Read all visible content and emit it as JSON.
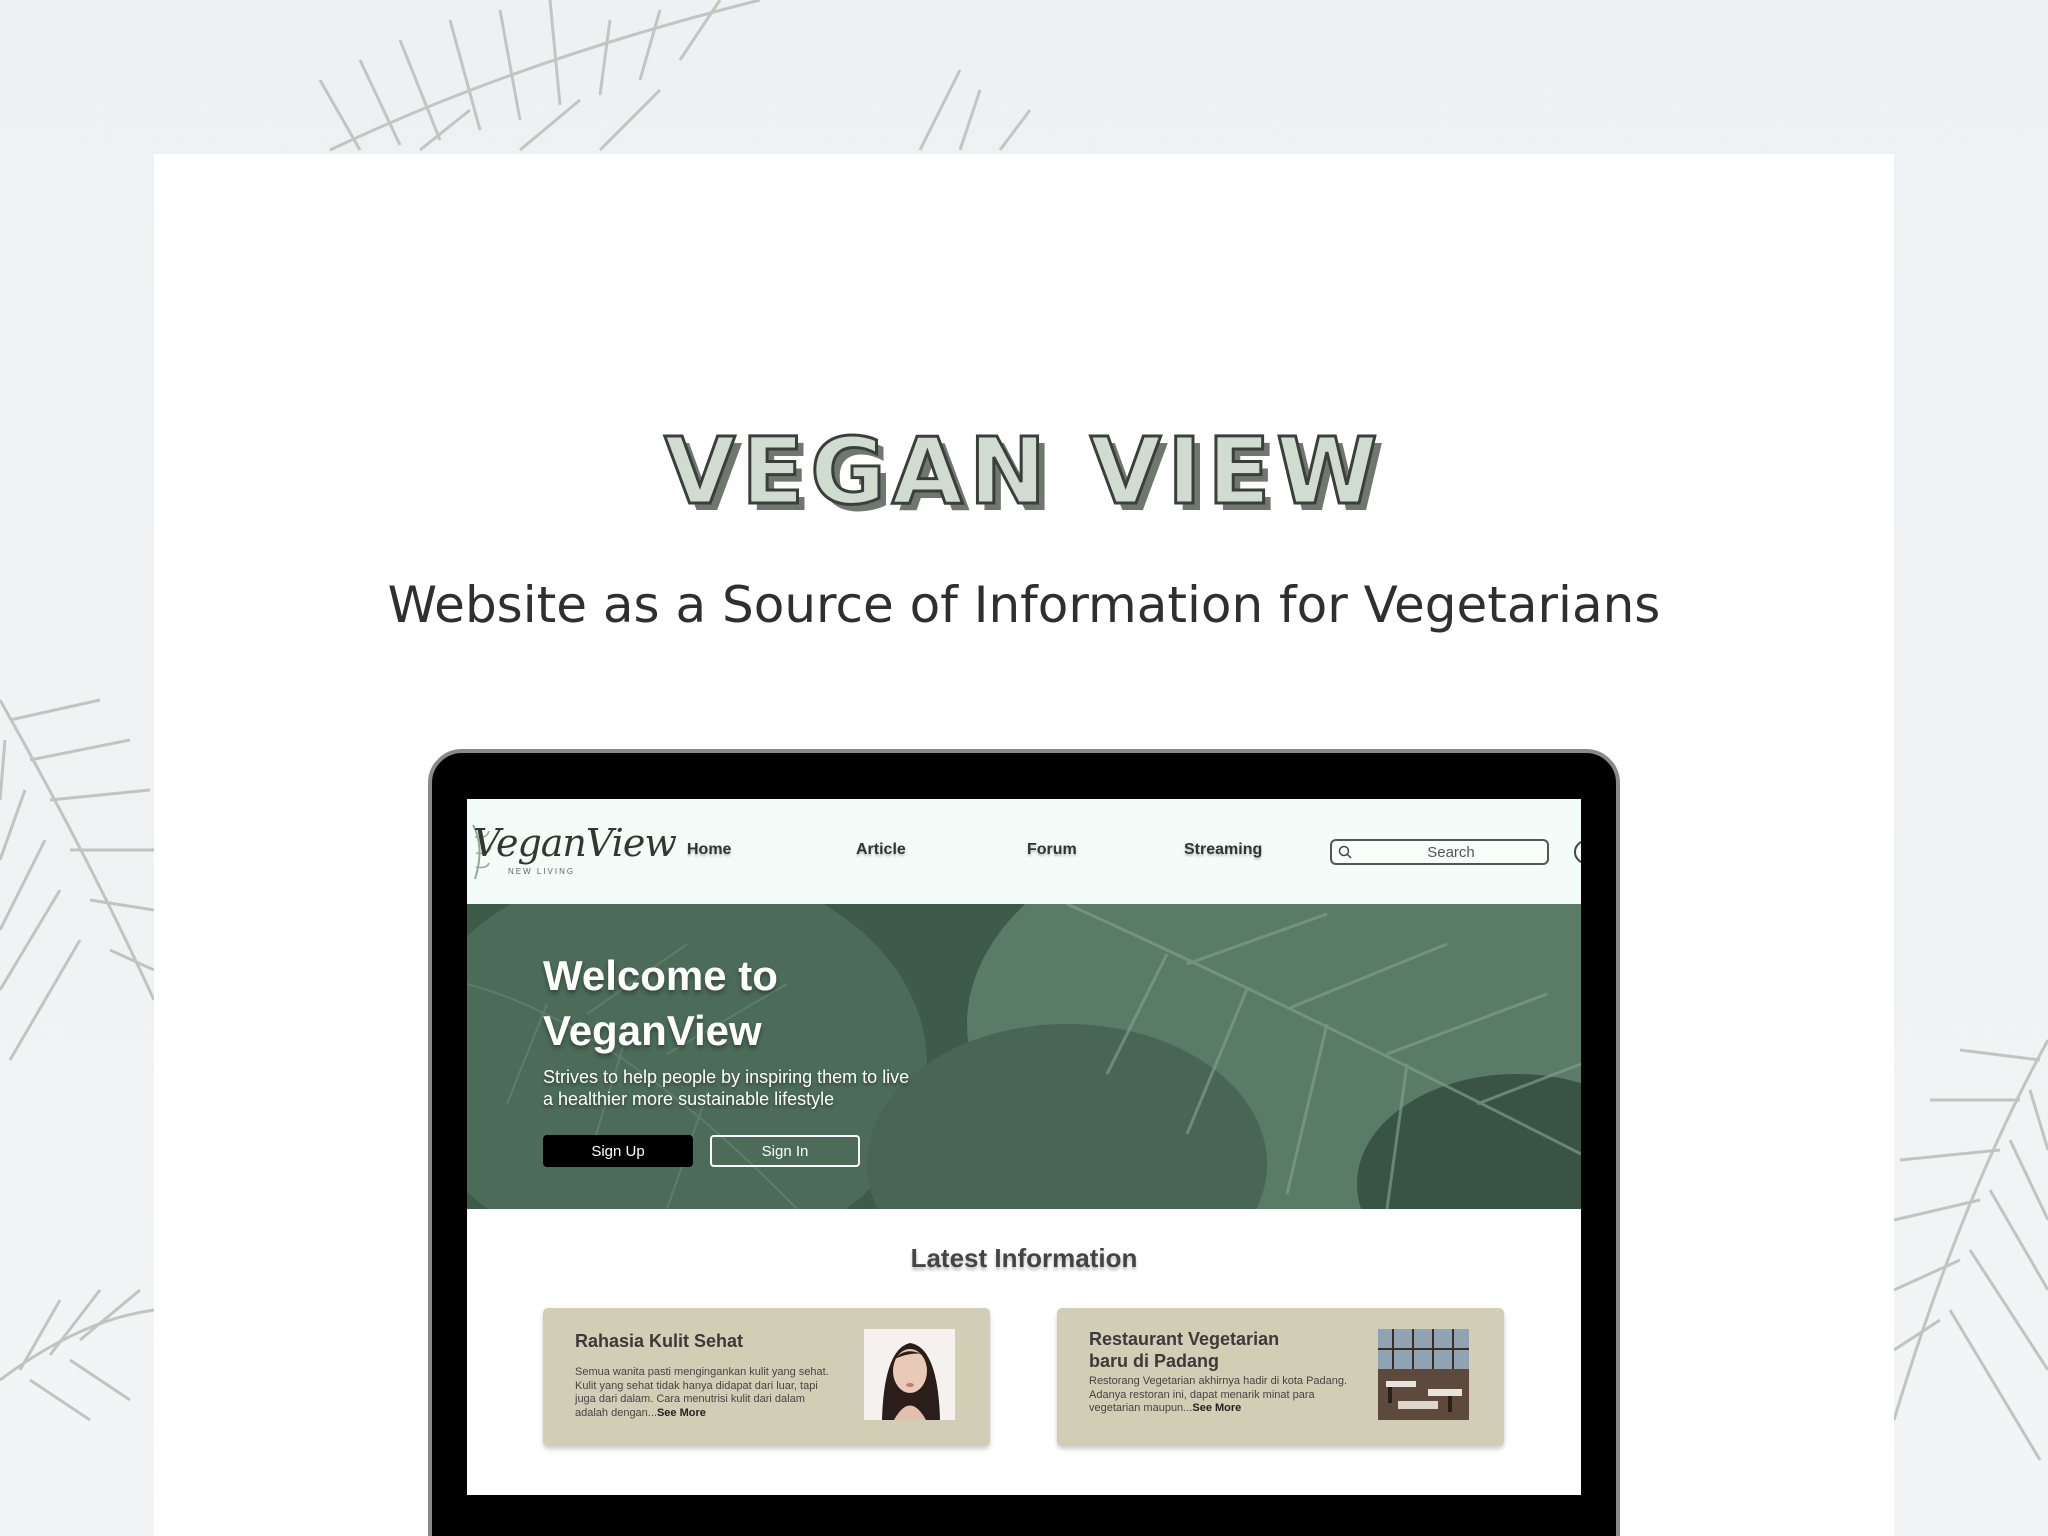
{
  "page": {
    "title": "VEGAN VIEW",
    "subtitle": "Website as a Source of Information for Vegetarians"
  },
  "site": {
    "logo": "VeganView",
    "logo_tagline": "NEW LIVING",
    "nav": [
      "Home",
      "Article",
      "Forum",
      "Streaming"
    ],
    "search_placeholder": "Search"
  },
  "hero": {
    "title_line1": "Welcome to",
    "title_line2": "VeganView",
    "text_line1": "Strives to help people by inspiring them to live",
    "text_line2": "a healthier more sustainable lifestyle",
    "signup_label": "Sign Up",
    "signin_label": "Sign In"
  },
  "latest": {
    "title": "Latest Information",
    "cards": [
      {
        "title": "Rahasia Kulit Sehat",
        "body": "Semua wanita pasti mengingankan kulit yang sehat. Kulit yang sehat tidak hanya didapat dari luar, tapi juga dari dalam. Cara menutrisi kulit dari dalam adalah dengan...",
        "more": "See More"
      },
      {
        "title_line1": "Restaurant Vegetarian",
        "title_line2": "baru di Padang",
        "body": "Restorang Vegetarian akhirnya hadir di kota Padang. Adanya restoran ini, dapat menarik minat para vegetarian maupun...",
        "more": "See More"
      }
    ]
  },
  "colors": {
    "header_bg": "#f3fcf8",
    "card_bg": "#d2cdb5",
    "hero_green": "#3d5a49",
    "title_fill": "#cfdccf"
  }
}
